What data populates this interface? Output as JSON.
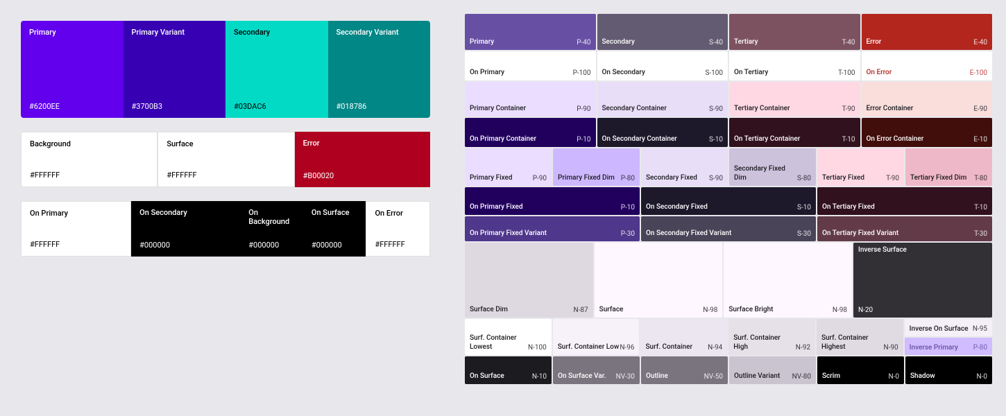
{
  "left": {
    "topRow": [
      {
        "label": "Primary",
        "hex": "#6200EE",
        "bg": "#6200EE",
        "textColor": "#fff"
      },
      {
        "label": "Primary Variant",
        "hex": "#3700B3",
        "bg": "#3700B3",
        "textColor": "#fff"
      },
      {
        "label": "Secondary",
        "hex": "#03DAC6",
        "bg": "#03DAC6",
        "textColor": "#000"
      },
      {
        "label": "Secondary Variant",
        "hex": "#018786",
        "bg": "#018786",
        "textColor": "#fff"
      }
    ],
    "midRow": [
      {
        "label": "Background",
        "hex": "#FFFFFF",
        "bg": "#FFFFFF",
        "textColor": "#000",
        "border": true
      },
      {
        "label": "Surface",
        "hex": "#FFFFFF",
        "bg": "#FFFFFF",
        "textColor": "#000",
        "border": true
      },
      {
        "label": "Error",
        "hex": "#B00020",
        "bg": "#B00020",
        "textColor": "#fff",
        "border": false
      }
    ],
    "botRow": [
      {
        "label": "On Primary",
        "hex": "#FFFFFF",
        "bg": "#FFFFFF",
        "textColor": "#000",
        "border": true
      },
      {
        "label": "On Secondary",
        "hex": "#000000",
        "bg": "#000000",
        "textColor": "#fff",
        "border": false
      },
      {
        "label": "On Background",
        "hex": "#000000",
        "bg": "#000000",
        "textColor": "#fff",
        "border": false
      },
      {
        "label": "On Surface",
        "hex": "#000000",
        "bg": "#000000",
        "textColor": "#fff",
        "border": false
      },
      {
        "label": "On Error",
        "hex": "#FFFFFF",
        "bg": "#FFFFFF",
        "textColor": "#000",
        "border": true
      }
    ]
  },
  "right": {
    "row1": [
      {
        "label": "Primary",
        "code": "P-40",
        "bg": "#6750A4",
        "textColor": "dark"
      },
      {
        "label": "Secondary",
        "code": "S-40",
        "bg": "#625B71",
        "textColor": "dark"
      },
      {
        "label": "Tertiary",
        "code": "T-40",
        "bg": "#7D5260",
        "textColor": "dark"
      },
      {
        "label": "Error",
        "code": "E-40",
        "bg": "#B3261E",
        "textColor": "dark"
      }
    ],
    "row2": [
      {
        "label": "On Primary",
        "code": "P-100",
        "bg": "#FFFFFF",
        "textColor": "light"
      },
      {
        "label": "On Secondary",
        "code": "S-100",
        "bg": "#FFFFFF",
        "textColor": "light"
      },
      {
        "label": "On Tertiary",
        "code": "T-100",
        "bg": "#FFFFFF",
        "textColor": "light"
      },
      {
        "label": "On Error",
        "code": "E-100",
        "bg": "#FFFFFF",
        "textColor": "red-accent"
      }
    ],
    "row3": [
      {
        "label": "Primary Container",
        "code": "P-90",
        "bg": "#EADDFF",
        "textColor": "light"
      },
      {
        "label": "Secondary Container",
        "code": "S-90",
        "bg": "#E8DEF8",
        "textColor": "light"
      },
      {
        "label": "Tertiary Container",
        "code": "T-90",
        "bg": "#FFD8E4",
        "textColor": "light"
      },
      {
        "label": "Error Container",
        "code": "E-90",
        "bg": "#F9DEDC",
        "textColor": "light"
      }
    ],
    "row4": [
      {
        "label": "On Primary Container",
        "code": "P-10",
        "bg": "#21005D",
        "textColor": "dark"
      },
      {
        "label": "On Secondary Container",
        "code": "S-10",
        "bg": "#1D192B",
        "textColor": "dark"
      },
      {
        "label": "On Tertiary Container",
        "code": "T-10",
        "bg": "#31111D",
        "textColor": "dark"
      },
      {
        "label": "On Error Container",
        "code": "E-10",
        "bg": "#410E0B",
        "textColor": "dark"
      }
    ],
    "row5": [
      {
        "label": "Primary Fixed",
        "code": "P-90",
        "bg": "#EADDFF",
        "textColor": "light"
      },
      {
        "label": "Primary Fixed Dim",
        "code": "P-80",
        "bg": "#CDB8FF",
        "textColor": "light"
      },
      {
        "label": "Secondary Fixed",
        "code": "S-90",
        "bg": "#E8DEF8",
        "textColor": "light"
      },
      {
        "label": "Secondary Fixed Dim",
        "code": "S-80",
        "bg": "#CCC2DC",
        "textColor": "light"
      },
      {
        "label": "Tertiary Fixed",
        "code": "T-90",
        "bg": "#FFD8E4",
        "textColor": "light"
      },
      {
        "label": "Tertiary Fixed Dim",
        "code": "T-80",
        "bg": "#EFB8C8",
        "textColor": "light"
      }
    ],
    "row6": [
      {
        "label": "On Primary Fixed",
        "code": "P-10",
        "bg": "#21005D",
        "textColor": "dark"
      },
      {
        "label": "On Secondary Fixed",
        "code": "S-10",
        "bg": "#1D192B",
        "textColor": "dark"
      },
      {
        "label": "On Tertiary Fixed",
        "code": "T-10",
        "bg": "#31111D",
        "textColor": "dark"
      }
    ],
    "row7": [
      {
        "label": "On Primary Fixed Variant",
        "code": "P-30",
        "bg": "#4F378B",
        "textColor": "dark"
      },
      {
        "label": "On Secondary Fixed Variant",
        "code": "S-30",
        "bg": "#4A4458",
        "textColor": "dark"
      },
      {
        "label": "On Tertiary Fixed Variant",
        "code": "T-30",
        "bg": "#633B48",
        "textColor": "dark"
      }
    ],
    "row8": [
      {
        "label": "Surface Dim",
        "code": "N-87",
        "bg": "#DED8E1",
        "textColor": "light"
      },
      {
        "label": "Surface",
        "code": "N-98",
        "bg": "#FEF7FF",
        "textColor": "light"
      },
      {
        "label": "Surface Bright",
        "code": "N-98",
        "bg": "#FEF7FF",
        "textColor": "light"
      },
      {
        "label": "Inverse Surface",
        "code": "N-20",
        "bg": "#322F35",
        "textColor": "dark"
      }
    ],
    "row9a": [
      {
        "label": "Surf. Container Lowest",
        "code": "N-100",
        "bg": "#FFFFFF",
        "textColor": "light"
      },
      {
        "label": "Surf. Container Low",
        "code": "N-96",
        "bg": "#F7F2FA",
        "textColor": "light"
      },
      {
        "label": "Surf. Container",
        "code": "N-94",
        "bg": "#ECE6F0",
        "textColor": "light"
      },
      {
        "label": "Surf. Container High",
        "code": "N-92",
        "bg": "#E6E0E9",
        "textColor": "light"
      },
      {
        "label": "Surf. Container Highest",
        "code": "N-90",
        "bg": "#E0DAE3",
        "textColor": "light"
      }
    ],
    "row9b": [
      {
        "label": "Inverse On Surface",
        "code": "N-95",
        "bg": "#F5EFF7",
        "textColor": "light"
      },
      {
        "label": "Inverse Primary",
        "code": "P-80",
        "bg": "#D0BCFF",
        "textColor": "accent"
      }
    ],
    "row10": [
      {
        "label": "On Surface",
        "code": "N-10",
        "bg": "#1C1B1F",
        "textColor": "dark"
      },
      {
        "label": "On Surface Var.",
        "code": "NV-30",
        "bg": "#79747E",
        "textColor": "dark"
      },
      {
        "label": "Outline",
        "code": "NV-50",
        "bg": "#79747E",
        "textColor": "dark"
      },
      {
        "label": "Outline Variant",
        "code": "NV-80",
        "bg": "#CAC4D0",
        "textColor": "light"
      },
      {
        "label": "Scrim",
        "code": "N-0",
        "bg": "#000000",
        "textColor": "dark"
      },
      {
        "label": "Shadow",
        "code": "N-0",
        "bg": "#000000",
        "textColor": "dark"
      }
    ]
  }
}
